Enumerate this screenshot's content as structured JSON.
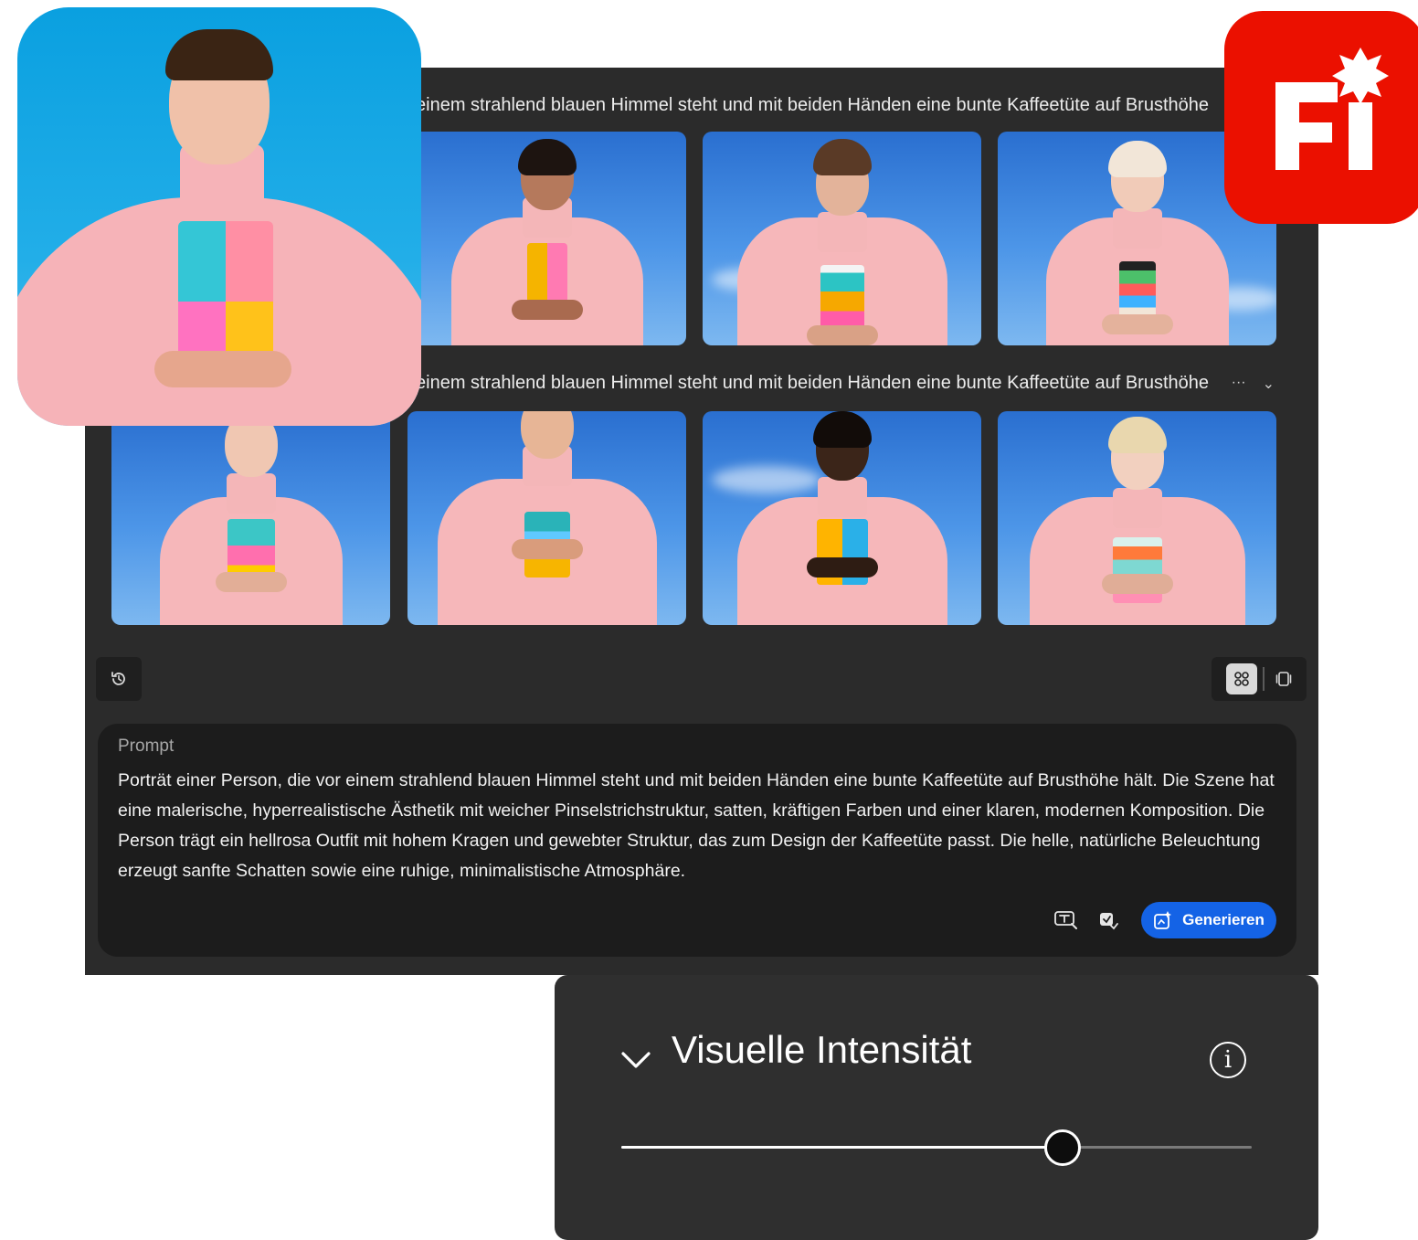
{
  "gallery": {
    "row1_prompt": "Porträt einer Person, die vor einem strahlend blauen Himmel steht und mit beiden Händen eine bunte Kaffeetüte auf Brusthöhe",
    "row2_prompt": "Porträt einer Person, die vor einem strahlend blauen Himmel steht und mit beiden Händen eine bunte Kaffeetüte auf Brusthöhe",
    "row_more_glyph": "···",
    "row_collapse_glyph": "⌄"
  },
  "toolbar": {
    "history_icon": "history-icon",
    "grid_view_icon": "grid-view-icon",
    "single_view_icon": "single-view-icon"
  },
  "prompt": {
    "label": "Prompt",
    "text": "Porträt einer Person, die vor einem strahlend blauen Himmel steht und mit beiden Händen eine bunte Kaffeetüte auf Brusthöhe hält. Die Szene hat eine malerische, hyperrealistische Ästhetik mit weicher Pinselstrichstruktur, satten, kräftigen Farben und einer klaren, modernen Komposition. Die Person trägt ein hellrosa Outfit mit hohem Kragen und gewebter Struktur, das zum Design der Kaffeetüte passt. Die helle, natürliche Beleuchtung erzeugt sanfte Schatten sowie eine ruhige, minimalistische Atmosphäre.",
    "generate_label": "Generieren"
  },
  "slider": {
    "title": "Visuelle Intensität",
    "info_glyph": "i",
    "value_fraction": 0.7
  },
  "colors": {
    "accent": "#1463e6",
    "logo": "#eb1000",
    "sky": "#4d96e8",
    "sweater": "#f6b7ba"
  },
  "logo": {
    "text": "Fi"
  }
}
